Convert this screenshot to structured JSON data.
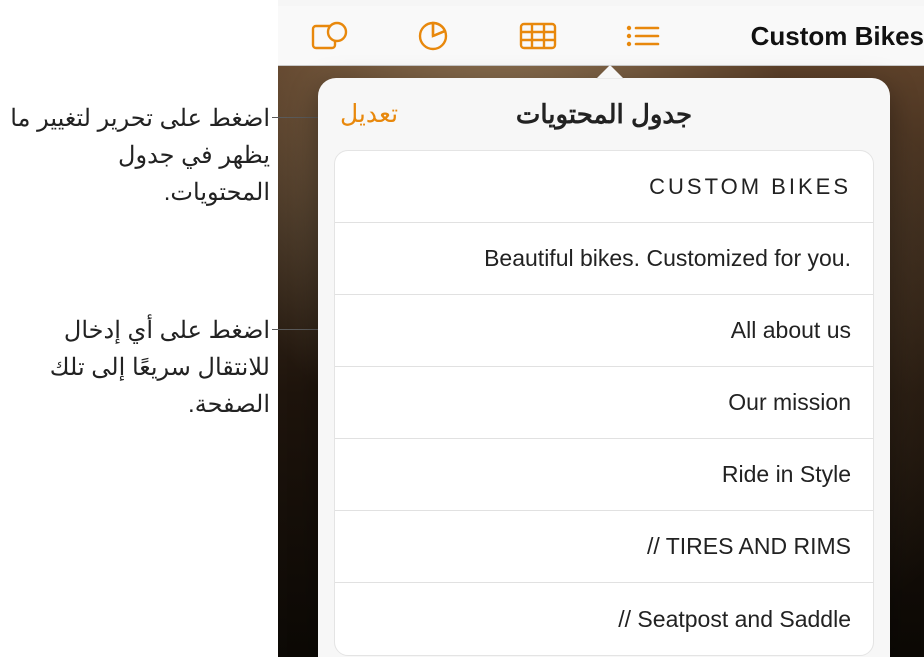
{
  "app": {
    "document_title": "Custom Bikes"
  },
  "toolbar": {
    "icons": {
      "shape": "shape-icon",
      "chart": "chart-icon",
      "table": "table-icon",
      "toc": "toc-icon"
    }
  },
  "popover": {
    "title": "جدول المحتويات",
    "edit_label": "تعديل"
  },
  "toc": {
    "entries": [
      "CUSTOM  BIKES",
      "Beautiful bikes. Customized for you.",
      "All about us",
      "Our mission",
      "Ride in Style",
      "// TIRES AND RIMS",
      "// Seatpost and Saddle"
    ]
  },
  "callouts": {
    "edit": "اضغط على تحرير لتغيير ما يظهر في جدول المحتويات.",
    "entry": "اضغط على أي إدخال للانتقال سريعًا إلى تلك الصفحة."
  },
  "colors": {
    "accent": "#e8880c"
  }
}
